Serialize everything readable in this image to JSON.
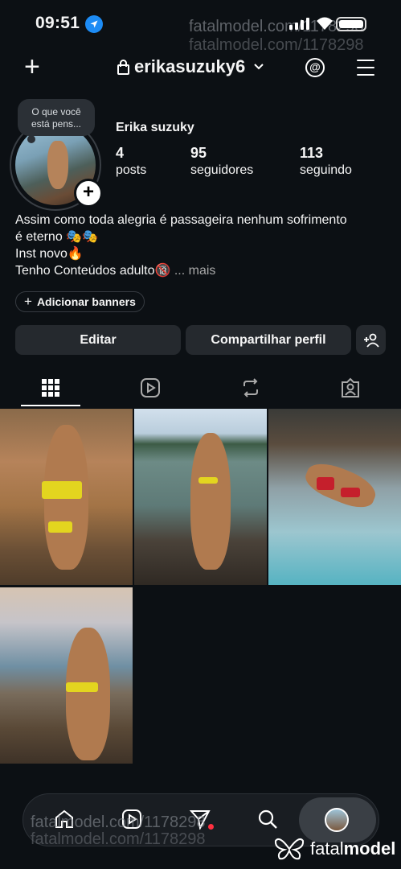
{
  "status_bar": {
    "time": "09:51"
  },
  "watermark": {
    "text": "fatalmodel.com/1178298"
  },
  "header": {
    "username": "erikasuzuky6"
  },
  "avatar_bubble": {
    "line1": "O que você",
    "line2": "está pens..."
  },
  "profile": {
    "name": "Erika suzuky",
    "stats": [
      {
        "value": "4",
        "label": "posts"
      },
      {
        "value": "95",
        "label": "seguidores"
      },
      {
        "value": "113",
        "label": "seguindo"
      }
    ]
  },
  "bio": {
    "line1": "Assim como toda alegria é passageira nenhum sofrimento",
    "line2": "é eterno 🎭🎭",
    "line3": "Inst novo🔥",
    "line4": "Tenho Conteúdos adulto🔞",
    "more": "... mais"
  },
  "banners": {
    "label": "Adicionar banners"
  },
  "actions": {
    "edit": "Editar",
    "share": "Compartilhar perfil"
  },
  "tabs": [
    "grid-icon",
    "reels-icon",
    "reposts-icon",
    "tagged-icon"
  ],
  "brand": {
    "fatal": "fatal",
    "model": "model"
  },
  "colors": {
    "background": "#0c1014",
    "button": "#25292e",
    "accent_blue": "#1d8cf5"
  }
}
